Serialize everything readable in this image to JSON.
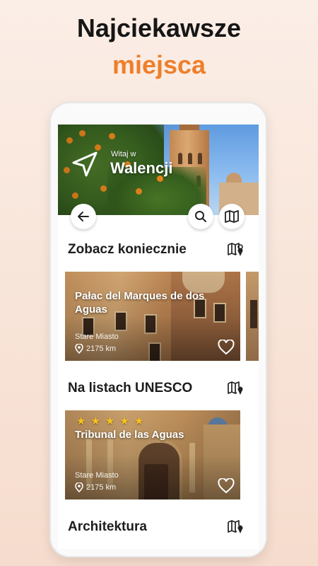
{
  "promo": {
    "title_line1": "Najciekawsze",
    "title_line2": "miejsca",
    "accent_color": "#ee7f2c"
  },
  "header": {
    "welcome": "Witaj w",
    "city": "Walencji",
    "icons": [
      "navigation-arrow-icon",
      "back-arrow-icon",
      "search-icon",
      "map-icon"
    ]
  },
  "sections": [
    {
      "title": "Zobacz koniecznie",
      "icon": "map-pin-icon",
      "cards": [
        {
          "title": "Pałac del Marques de dos Aguas",
          "area": "Stare Miasto",
          "distance": "2175 km",
          "favorite": false
        }
      ]
    },
    {
      "title": "Na listach UNESCO",
      "icon": "map-pin-icon",
      "cards": [
        {
          "title": "Tribunal de las Aguas",
          "area": "Stare Miasto",
          "distance": "2175 km",
          "rating": 5,
          "favorite": false
        }
      ]
    },
    {
      "title": "Architektura",
      "icon": "map-pin-icon"
    }
  ]
}
